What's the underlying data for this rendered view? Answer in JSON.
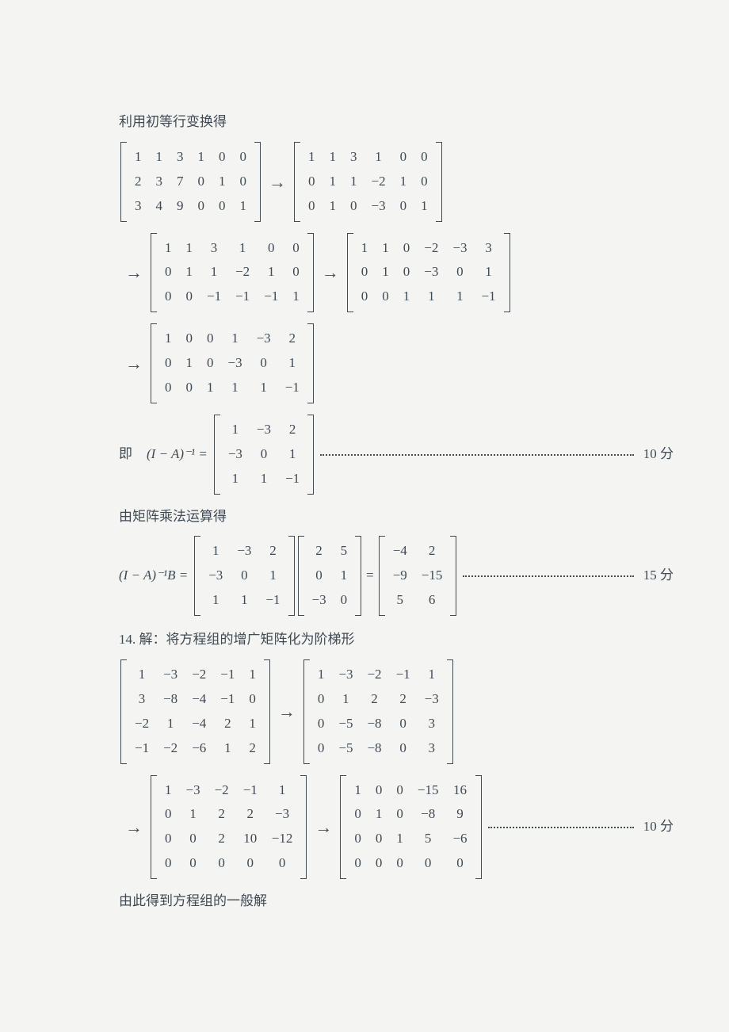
{
  "text": {
    "intro13": "利用初等行变换得",
    "ji": "即",
    "inv_lhs": "(I − A)⁻¹ =",
    "by_mult": "由矩阵乘法运算得",
    "prod_lhs": "(I − A)⁻¹B =",
    "eq": "=",
    "q14_intro": "14. 解：将方程组的增广矩阵化为阶梯形",
    "q14_tail": "由此得到方程组的一般解",
    "score10": "10 分",
    "score15": "15 分",
    "arrow": "→"
  },
  "m": {
    "a1": [
      [
        "1",
        "1",
        "3",
        "1",
        "0",
        "0"
      ],
      [
        "2",
        "3",
        "7",
        "0",
        "1",
        "0"
      ],
      [
        "3",
        "4",
        "9",
        "0",
        "0",
        "1"
      ]
    ],
    "a2": [
      [
        "1",
        "1",
        "3",
        "1",
        "0",
        "0"
      ],
      [
        "0",
        "1",
        "1",
        "−2",
        "1",
        "0"
      ],
      [
        "0",
        "1",
        "0",
        "−3",
        "0",
        "1"
      ]
    ],
    "a3": [
      [
        "1",
        "1",
        "3",
        "1",
        "0",
        "0"
      ],
      [
        "0",
        "1",
        "1",
        "−2",
        "1",
        "0"
      ],
      [
        "0",
        "0",
        "−1",
        "−1",
        "−1",
        "1"
      ]
    ],
    "a4": [
      [
        "1",
        "1",
        "0",
        "−2",
        "−3",
        "3"
      ],
      [
        "0",
        "1",
        "0",
        "−3",
        "0",
        "1"
      ],
      [
        "0",
        "0",
        "1",
        "1",
        "1",
        "−1"
      ]
    ],
    "a5": [
      [
        "1",
        "0",
        "0",
        "1",
        "−3",
        "2"
      ],
      [
        "0",
        "1",
        "0",
        "−3",
        "0",
        "1"
      ],
      [
        "0",
        "0",
        "1",
        "1",
        "1",
        "−1"
      ]
    ],
    "inv": [
      [
        "1",
        "−3",
        "2"
      ],
      [
        "−3",
        "0",
        "1"
      ],
      [
        "1",
        "1",
        "−1"
      ]
    ],
    "B": [
      [
        "2",
        "5"
      ],
      [
        "0",
        "1"
      ],
      [
        "−3",
        "0"
      ]
    ],
    "res": [
      [
        "−4",
        "2"
      ],
      [
        "−9",
        "−15"
      ],
      [
        "5",
        "6"
      ]
    ],
    "c1": [
      [
        "1",
        "−3",
        "−2",
        "−1",
        "1"
      ],
      [
        "3",
        "−8",
        "−4",
        "−1",
        "0"
      ],
      [
        "−2",
        "1",
        "−4",
        "2",
        "1"
      ],
      [
        "−1",
        "−2",
        "−6",
        "1",
        "2"
      ]
    ],
    "c2": [
      [
        "1",
        "−3",
        "−2",
        "−1",
        "1"
      ],
      [
        "0",
        "1",
        "2",
        "2",
        "−3"
      ],
      [
        "0",
        "−5",
        "−8",
        "0",
        "3"
      ],
      [
        "0",
        "−5",
        "−8",
        "0",
        "3"
      ]
    ],
    "c3": [
      [
        "1",
        "−3",
        "−2",
        "−1",
        "1"
      ],
      [
        "0",
        "1",
        "2",
        "2",
        "−3"
      ],
      [
        "0",
        "0",
        "2",
        "10",
        "−12"
      ],
      [
        "0",
        "0",
        "0",
        "0",
        "0"
      ]
    ],
    "c4": [
      [
        "1",
        "0",
        "0",
        "−15",
        "16"
      ],
      [
        "0",
        "1",
        "0",
        "−8",
        "9"
      ],
      [
        "0",
        "0",
        "1",
        "5",
        "−6"
      ],
      [
        "0",
        "0",
        "0",
        "0",
        "0"
      ]
    ]
  }
}
